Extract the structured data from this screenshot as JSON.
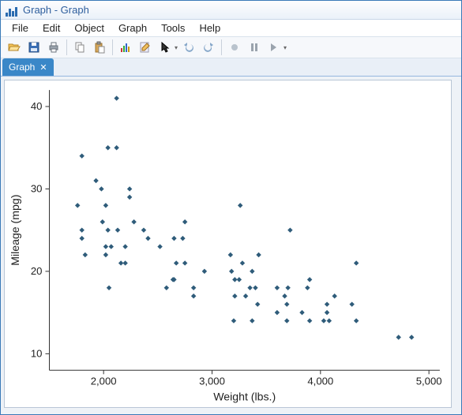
{
  "window": {
    "title": "Graph - Graph"
  },
  "menu": {
    "items": [
      "File",
      "Edit",
      "Object",
      "Graph",
      "Tools",
      "Help"
    ]
  },
  "toolbar": {
    "icons": [
      "open-icon",
      "save-icon",
      "print-icon",
      "copy-icon",
      "paste-icon",
      "edit-graph-icon",
      "rename-icon",
      "pointer-icon",
      "undo-icon",
      "redo-icon",
      "start-icon",
      "pause-icon",
      "step-icon"
    ]
  },
  "tabs": {
    "active": {
      "label": "Graph",
      "closable": true
    }
  },
  "chart_data": {
    "type": "scatter",
    "xlabel": "Weight (lbs.)",
    "ylabel": "Mileage (mpg)",
    "xlim": [
      1500,
      5100
    ],
    "ylim": [
      8,
      42
    ],
    "xticks": [
      2000,
      3000,
      4000,
      5000
    ],
    "yticks": [
      10,
      20,
      30,
      40
    ],
    "points": [
      [
        1760,
        28
      ],
      [
        1800,
        24
      ],
      [
        1800,
        25
      ],
      [
        1800,
        34
      ],
      [
        1830,
        22
      ],
      [
        1930,
        31
      ],
      [
        1980,
        30
      ],
      [
        1990,
        26
      ],
      [
        2020,
        22
      ],
      [
        2020,
        23
      ],
      [
        2020,
        28
      ],
      [
        2040,
        25
      ],
      [
        2040,
        35
      ],
      [
        2050,
        18
      ],
      [
        2070,
        23
      ],
      [
        2120,
        35
      ],
      [
        2120,
        41
      ],
      [
        2130,
        25
      ],
      [
        2160,
        21
      ],
      [
        2200,
        21
      ],
      [
        2200,
        23
      ],
      [
        2240,
        29
      ],
      [
        2240,
        30
      ],
      [
        2280,
        26
      ],
      [
        2370,
        25
      ],
      [
        2410,
        24
      ],
      [
        2520,
        23
      ],
      [
        2580,
        18
      ],
      [
        2640,
        19
      ],
      [
        2650,
        19
      ],
      [
        2650,
        24
      ],
      [
        2670,
        21
      ],
      [
        2730,
        24
      ],
      [
        2750,
        21
      ],
      [
        2750,
        26
      ],
      [
        2830,
        17
      ],
      [
        2830,
        18
      ],
      [
        2930,
        20
      ],
      [
        3170,
        22
      ],
      [
        3180,
        20
      ],
      [
        3200,
        14
      ],
      [
        3210,
        17
      ],
      [
        3210,
        19
      ],
      [
        3250,
        19
      ],
      [
        3260,
        28
      ],
      [
        3280,
        21
      ],
      [
        3310,
        17
      ],
      [
        3350,
        18
      ],
      [
        3370,
        14
      ],
      [
        3370,
        20
      ],
      [
        3400,
        18
      ],
      [
        3420,
        16
      ],
      [
        3430,
        22
      ],
      [
        3600,
        15
      ],
      [
        3600,
        18
      ],
      [
        3670,
        17
      ],
      [
        3690,
        14
      ],
      [
        3690,
        16
      ],
      [
        3700,
        18
      ],
      [
        3720,
        25
      ],
      [
        3830,
        15
      ],
      [
        3880,
        18
      ],
      [
        3900,
        14
      ],
      [
        3900,
        19
      ],
      [
        4030,
        14
      ],
      [
        4060,
        15
      ],
      [
        4060,
        16
      ],
      [
        4080,
        14
      ],
      [
        4130,
        17
      ],
      [
        4290,
        16
      ],
      [
        4330,
        14
      ],
      [
        4330,
        21
      ],
      [
        4720,
        12
      ],
      [
        4840,
        12
      ]
    ]
  }
}
